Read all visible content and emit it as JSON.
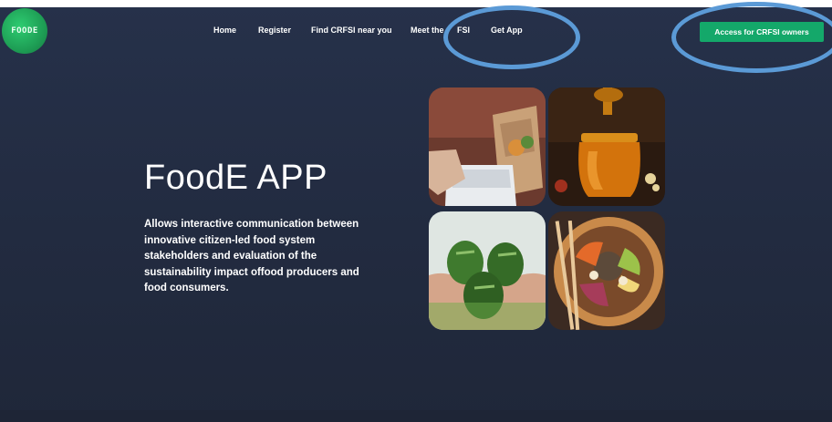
{
  "brand": {
    "logo_text": "FOODE"
  },
  "nav": {
    "items": [
      {
        "label": "Home"
      },
      {
        "label": "Register"
      },
      {
        "label": "Find CRFSI near you"
      },
      {
        "label": "Meet the"
      },
      {
        "label": "FSI"
      },
      {
        "label": "Get App"
      }
    ]
  },
  "cta": {
    "label": "Access for CRFSI owners",
    "color": "#14a86a"
  },
  "hero": {
    "title": "FoodE APP",
    "description": "Allows interactive communication between innovative citizen-led food system stakeholders and evaluation of the sustainability impact offood producers and food consumers."
  },
  "gallery": {
    "images": [
      {
        "subject": "grocery-bag-image"
      },
      {
        "subject": "honey-jar-image"
      },
      {
        "subject": "zucchini-hands-image"
      },
      {
        "subject": "salad-bowl-image"
      }
    ]
  },
  "annotations": {
    "highlight_color": "#5b9ad6"
  },
  "theme": {
    "background": "#232c42",
    "accent": "#14a86a"
  }
}
